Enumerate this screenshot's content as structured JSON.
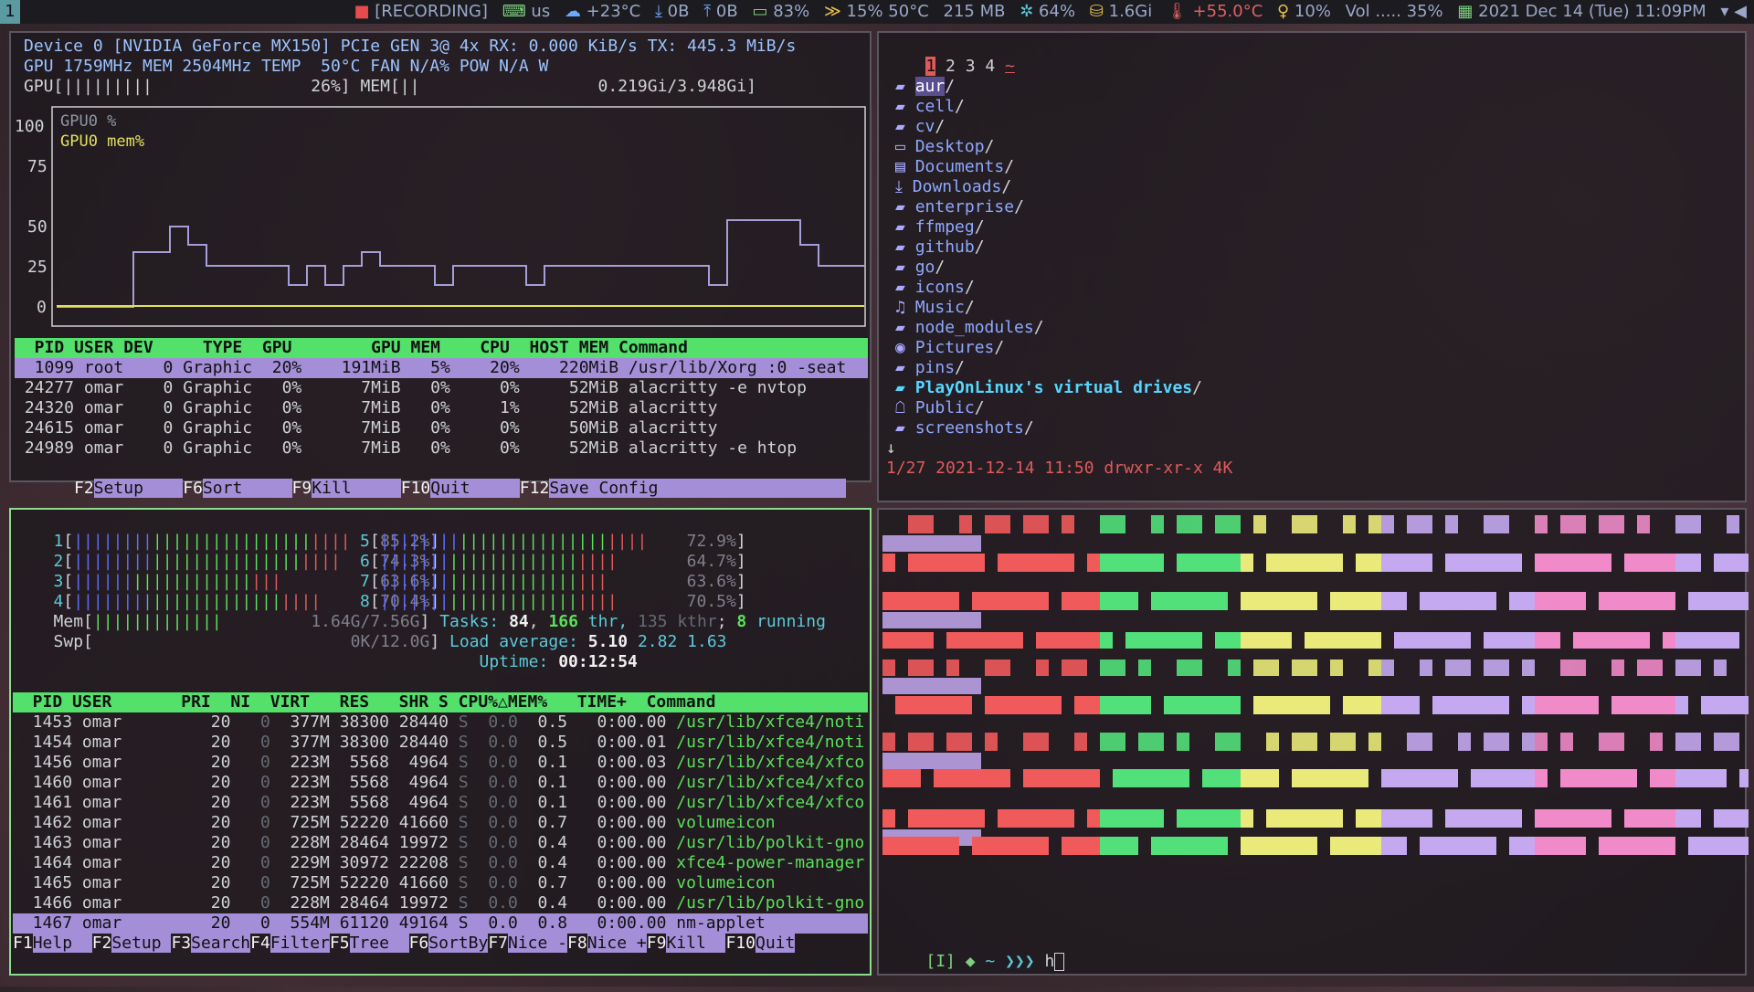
{
  "topbar": {
    "workspace": "1",
    "recording": "[RECORDING]",
    "layout": "us",
    "weather": "+23°C",
    "net_down": "0B",
    "net_up": "0B",
    "battery": "83%",
    "cpu": "15%",
    "cpu_temp": "50°C",
    "mem": "215 MB",
    "fan": "64%",
    "disk": "1.6Gi",
    "temp2": "+55.0°C",
    "brightness": "10%",
    "volume": "Vol ..... 35%",
    "datetime": "2021 Dec 14 (Tue) 11:09PM"
  },
  "nvtop": {
    "line1": "Device 0 [NVIDIA GeForce MX150] PCIe GEN 3@ 4x RX: 0.000 KiB/s TX: 445.3 MiB/s",
    "line2": "GPU 1759MHz MEM 2504MHz TEMP  50°C FAN N/A% POW N/A W",
    "line3": "GPU[|||||||||                26%] MEM[||                  0.219Gi/3.948Gi]",
    "y_labels": [
      "100",
      "75",
      "50",
      "25",
      "0"
    ],
    "legend1": "GPU0 %",
    "legend2": "GPU0 mem%",
    "header": "  PID USER DEV     TYPE  GPU        GPU MEM    CPU  HOST MEM Command",
    "rows": [
      "  1099 root    0 Graphic  20%    191MiB   5%    20%    220MiB /usr/lib/Xorg :0 -seat",
      " 24277 omar    0 Graphic   0%      7MiB   0%     0%     52MiB alacritty -e nvtop",
      " 24320 omar    0 Graphic   0%      7MiB   0%     1%     52MiB alacritty",
      " 24615 omar    0 Graphic   0%      7MiB   0%     0%     50MiB alacritty",
      " 24989 omar    0 Graphic   0%      7MiB   0%     0%     52MiB alacritty -e htop"
    ],
    "fkeys": [
      {
        "key": "F2",
        "label": "Setup    "
      },
      {
        "key": "F6",
        "label": "Sort     "
      },
      {
        "key": "F9",
        "label": "Kill     "
      },
      {
        "key": "F10",
        "label": "Quit     "
      },
      {
        "key": "F12",
        "label": "Save Config                   "
      }
    ]
  },
  "files": {
    "tabs": [
      "1",
      "2",
      "3",
      "4",
      "~"
    ],
    "entries": [
      {
        "name": "aur",
        "icon": "folder-icon"
      },
      {
        "name": "cell",
        "icon": "folder-icon"
      },
      {
        "name": "cv",
        "icon": "folder-icon"
      },
      {
        "name": "Desktop",
        "icon": "desktop-icon"
      },
      {
        "name": "Documents",
        "icon": "documents-icon"
      },
      {
        "name": "Downloads",
        "icon": "download-icon"
      },
      {
        "name": "enterprise",
        "icon": "folder-icon"
      },
      {
        "name": "ffmpeg",
        "icon": "folder-icon"
      },
      {
        "name": "github",
        "icon": "folder-icon"
      },
      {
        "name": "go",
        "icon": "folder-icon"
      },
      {
        "name": "icons",
        "icon": "folder-icon"
      },
      {
        "name": "Music",
        "icon": "music-icon"
      },
      {
        "name": "node_modules",
        "icon": "folder-icon"
      },
      {
        "name": "Pictures",
        "icon": "camera-icon"
      },
      {
        "name": "pins",
        "icon": "folder-icon"
      },
      {
        "name": "PlayOnLinux's virtual drives",
        "icon": "folder-icon"
      },
      {
        "name": "Public",
        "icon": "public-icon"
      },
      {
        "name": "screenshots",
        "icon": "folder-icon"
      }
    ],
    "more": "↓",
    "status": "1/27 2021-12-14 11:50 drwxr-xr-x 4K"
  },
  "htop": {
    "cpus": [
      {
        "label": "1",
        "bar": "||||||||||||||||||||||||||||",
        "val": "85.2%"
      },
      {
        "label": "2",
        "bar": "|||||||||||||||||||||||||||",
        "val": "74.3%"
      },
      {
        "label": "3",
        "bar": "|||||||||||||||||||||",
        "val": "63.6%"
      },
      {
        "label": "4",
        "bar": "|||||||||||||||||||||||||",
        "val": "70.4%"
      },
      {
        "label": "5",
        "bar": "|||||||||||||||||||||||||||",
        "val": "72.9%"
      },
      {
        "label": "6",
        "bar": "||||||||||||||||||||||||",
        "val": "64.7%"
      },
      {
        "label": "7",
        "bar": "|||||||||||||||||||||||",
        "val": "63.6%"
      },
      {
        "label": "8",
        "bar": "||||||||||||||||||||||||",
        "val": "70.5%"
      }
    ],
    "mem_label": "Mem",
    "mem_bar": "|||||||||||||",
    "mem_val": "1.64G/7.56G",
    "swp_label": "Swp",
    "swp_val": "0K/12.0G",
    "tasks_label": "Tasks: ",
    "tasks": "84",
    "thr": "166",
    "thr_label": " thr, ",
    "kthr": "135 kthr",
    "running": "8",
    "running_label": " running",
    "load_label": "Load average: ",
    "load1": "5.10",
    "load2": "2.82",
    "load3": "1.63",
    "uptime_label": "Uptime: ",
    "uptime": "00:12:54",
    "header": "  PID USER       PRI  NI  VIRT   RES   SHR S CPU%△MEM%   TIME+  Command",
    "rows": [
      {
        "pid": " 1453",
        "user": "omar",
        "pri": "20",
        "ni": "0",
        "virt": "377M",
        "res": "38300",
        "shr": "28440",
        "s": "S",
        "cpu": "0.0",
        "mem": "0.5",
        "time": "0:00.00",
        "cmd": "/usr/lib/xfce4/noti"
      },
      {
        "pid": " 1454",
        "user": "omar",
        "pri": "20",
        "ni": "0",
        "virt": "377M",
        "res": "38300",
        "shr": "28440",
        "s": "S",
        "cpu": "0.0",
        "mem": "0.5",
        "time": "0:00.01",
        "cmd": "/usr/lib/xfce4/noti"
      },
      {
        "pid": " 1456",
        "user": "omar",
        "pri": "20",
        "ni": "0",
        "virt": "223M",
        "res": "5568",
        "shr": "4964",
        "s": "S",
        "cpu": "0.0",
        "mem": "0.1",
        "time": "0:00.03",
        "cmd": "/usr/lib/xfce4/xfco"
      },
      {
        "pid": " 1460",
        "user": "omar",
        "pri": "20",
        "ni": "0",
        "virt": "223M",
        "res": "5568",
        "shr": "4964",
        "s": "S",
        "cpu": "0.0",
        "mem": "0.1",
        "time": "0:00.00",
        "cmd": "/usr/lib/xfce4/xfco"
      },
      {
        "pid": " 1461",
        "user": "omar",
        "pri": "20",
        "ni": "0",
        "virt": "223M",
        "res": "5568",
        "shr": "4964",
        "s": "S",
        "cpu": "0.0",
        "mem": "0.1",
        "time": "0:00.00",
        "cmd": "/usr/lib/xfce4/xfco"
      },
      {
        "pid": " 1462",
        "user": "omar",
        "pri": "20",
        "ni": "0",
        "virt": "725M",
        "res": "52220",
        "shr": "41660",
        "s": "S",
        "cpu": "0.0",
        "mem": "0.7",
        "time": "0:00.00",
        "cmd": "volumeicon"
      },
      {
        "pid": " 1463",
        "user": "omar",
        "pri": "20",
        "ni": "0",
        "virt": "228M",
        "res": "28464",
        "shr": "19972",
        "s": "S",
        "cpu": "0.0",
        "mem": "0.4",
        "time": "0:00.00",
        "cmd": "/usr/lib/polkit-gno"
      },
      {
        "pid": " 1464",
        "user": "omar",
        "pri": "20",
        "ni": "0",
        "virt": "229M",
        "res": "30972",
        "shr": "22208",
        "s": "S",
        "cpu": "0.0",
        "mem": "0.4",
        "time": "0:00.00",
        "cmd": "xfce4-power-manager"
      },
      {
        "pid": " 1465",
        "user": "omar",
        "pri": "20",
        "ni": "0",
        "virt": "725M",
        "res": "52220",
        "shr": "41660",
        "s": "S",
        "cpu": "0.0",
        "mem": "0.7",
        "time": "0:00.00",
        "cmd": "volumeicon"
      },
      {
        "pid": " 1466",
        "user": "omar",
        "pri": "20",
        "ni": "0",
        "virt": "228M",
        "res": "28464",
        "shr": "19972",
        "s": "S",
        "cpu": "0.0",
        "mem": "0.4",
        "time": "0:00.00",
        "cmd": "/usr/lib/polkit-gno"
      },
      {
        "pid": " 1467",
        "user": "omar",
        "pri": "20",
        "ni": "0",
        "virt": "554M",
        "res": "61120",
        "shr": "49164",
        "s": "S",
        "cpu": "0.0",
        "mem": "0.8",
        "time": "0:00.00",
        "cmd": "nm-applet"
      }
    ],
    "fkeys": [
      {
        "key": "F1",
        "label": "Help  "
      },
      {
        "key": "F2",
        "label": "Setup "
      },
      {
        "key": "F3",
        "label": "Search"
      },
      {
        "key": "F4",
        "label": "Filter"
      },
      {
        "key": "F5",
        "label": "Tree  "
      },
      {
        "key": "F6",
        "label": "SortBy"
      },
      {
        "key": "F7",
        "label": "Nice -"
      },
      {
        "key": "F8",
        "label": "Nice +"
      },
      {
        "key": "F9",
        "label": "Kill  "
      },
      {
        "key": "F10",
        "label": "Quit"
      }
    ]
  },
  "shell": {
    "mode": "[I]",
    "diamond": "◆",
    "path": "~",
    "arrows": "❯❯❯",
    "input": "h"
  },
  "colors": {
    "accent_green": "#53e06b",
    "selection_purple": "#a48ed8",
    "block_red": "#f05a5a",
    "block_green": "#52e07a",
    "block_yellow": "#eaea7a",
    "block_purple": "#c4a8f0",
    "block_pink": "#f08ac8"
  }
}
